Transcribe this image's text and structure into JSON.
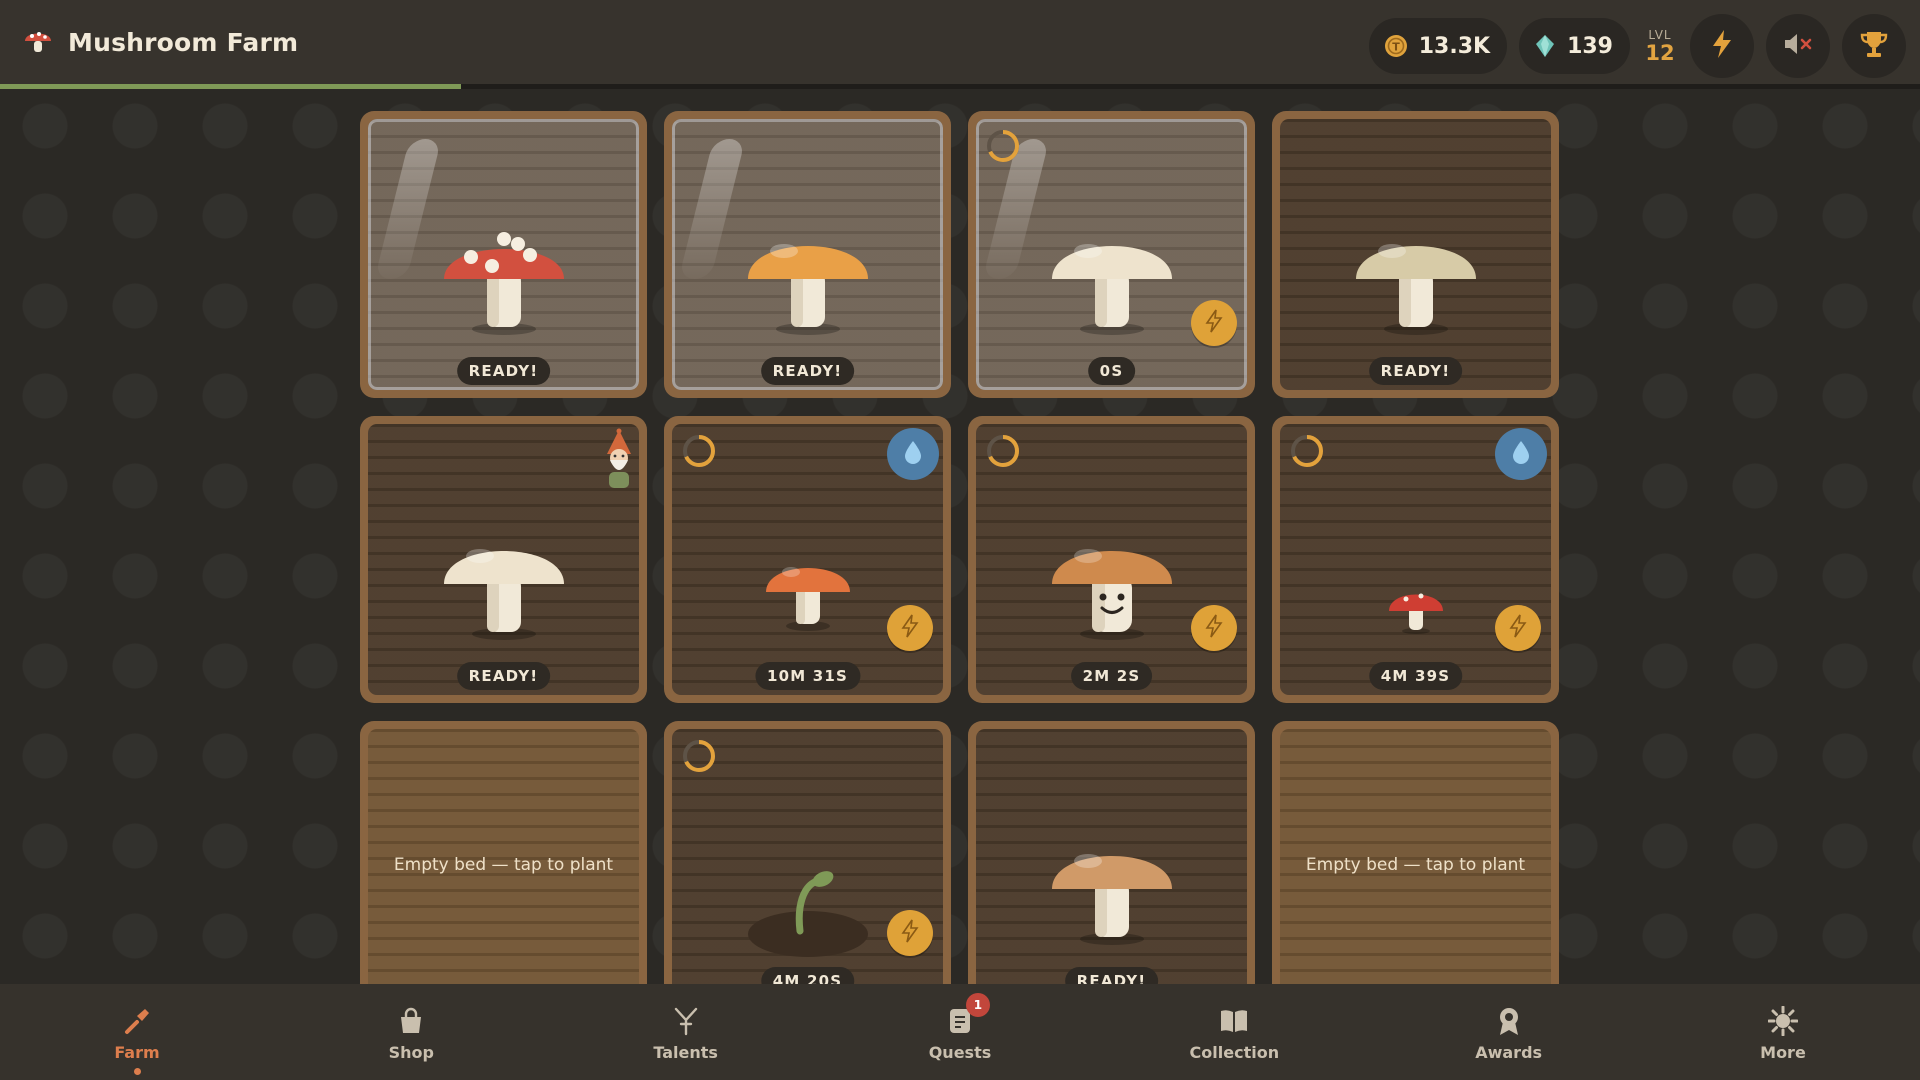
{
  "app": {
    "title": "Mushroom Farm",
    "logo_icon": "mushroom-logo-icon"
  },
  "xp_progress": 0.24,
  "hud": {
    "coins": "13.3K",
    "gems": "139",
    "level_label": "LVL",
    "level": "12"
  },
  "beds": [
    {
      "status": "READY!",
      "cover": "glass",
      "mushroom": "fly-agaric",
      "cap_color": "#d2503f"
    },
    {
      "status": "READY!",
      "cover": "glass",
      "mushroom": "golden",
      "cap_color": "#e9a047"
    },
    {
      "status": "0S",
      "cover": "glass",
      "mushroom": "white",
      "cap_color": "#eee3cd",
      "boost": true,
      "timer": true
    },
    {
      "status": "READY!",
      "mushroom": "beige",
      "cap_color": "#d7cba7"
    },
    {
      "status": "READY!",
      "mushroom": "white",
      "cap_color": "#eee3cd",
      "gnome": true
    },
    {
      "status": "10M 31S",
      "mushroom": "orange-small",
      "cap_color": "#e2733d",
      "water": true,
      "boost": true,
      "timer": true
    },
    {
      "status": "2M 2S",
      "mushroom": "smiley",
      "cap_color": "#cf8a4d",
      "boost": true,
      "timer": true
    },
    {
      "status": "4M 39S",
      "mushroom": "red-tiny",
      "cap_color": "#cf3e33",
      "water": true,
      "boost": true,
      "timer": true
    },
    {
      "empty": true,
      "empty_text": "Empty bed — tap to plant"
    },
    {
      "status": "4M 20S",
      "mushroom": "sprout",
      "boost": true,
      "timer": true
    },
    {
      "status": "READY!",
      "mushroom": "tan",
      "cap_color": "#d09a68"
    },
    {
      "empty": true,
      "empty_text": "Empty bed — tap to plant"
    }
  ],
  "nav": [
    {
      "label": "Farm",
      "icon": "shovel-icon",
      "active": true
    },
    {
      "label": "Shop",
      "icon": "shopping-bag-icon"
    },
    {
      "label": "Talents",
      "icon": "talents-icon"
    },
    {
      "label": "Quests",
      "icon": "quest-scroll-icon",
      "badge": "1"
    },
    {
      "label": "Collection",
      "icon": "book-icon"
    },
    {
      "label": "Awards",
      "icon": "award-ribbon-icon"
    },
    {
      "label": "More",
      "icon": "gear-icon"
    }
  ],
  "colors": {
    "accent": "#dd7e4d",
    "gold": "#dfa238",
    "water": "#4e7ea7",
    "xp": "#7f9a57"
  }
}
